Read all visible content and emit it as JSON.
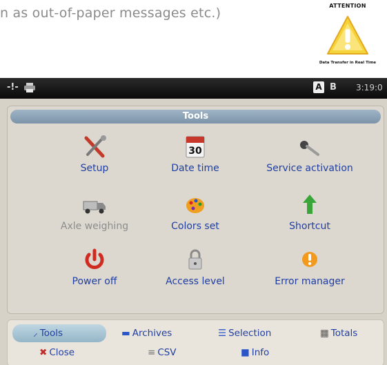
{
  "caption": {
    "text": "n as out-of-paper messages etc.)"
  },
  "attention": {
    "title": "ATTENTION",
    "subtitle": "Data Transfer in Real Time"
  },
  "statusbar": {
    "left_glyph": "-!-",
    "indicator_a": "A",
    "indicator_b": "B",
    "time": "3:19:0"
  },
  "tools_panel": {
    "title": "Tools",
    "items": [
      {
        "label": "Setup",
        "icon": "tools-icon"
      },
      {
        "label": "Date time",
        "icon": "calendar-icon",
        "icon_text": "30"
      },
      {
        "label": "Service activation",
        "icon": "key-icon"
      },
      {
        "label": "Axle weighing",
        "icon": "truck-icon",
        "disabled": true
      },
      {
        "label": "Colors set",
        "icon": "palette-icon"
      },
      {
        "label": "Shortcut",
        "icon": "arrow-up-icon"
      },
      {
        "label": "Power off",
        "icon": "power-icon"
      },
      {
        "label": "Access level",
        "icon": "padlock-icon"
      },
      {
        "label": "Error manager",
        "icon": "warning-icon"
      }
    ]
  },
  "bottom_tabs": {
    "row1": [
      {
        "label": "Tools",
        "active": true
      },
      {
        "label": "Archives"
      },
      {
        "label": "Selection"
      },
      {
        "label": "Totals"
      }
    ],
    "row2": [
      {
        "label": "Close"
      },
      {
        "label": "CSV"
      },
      {
        "label": "Info"
      }
    ]
  },
  "colors": {
    "link_blue": "#1f3ea2",
    "panel_header": "#8aa1b5",
    "status_bar": "#111111"
  }
}
